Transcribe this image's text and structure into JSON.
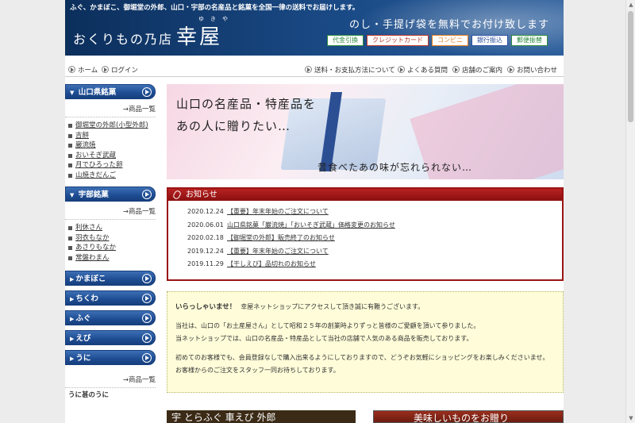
{
  "header": {
    "tagline": "ふぐ、かまぼこ、御堀堂の外郎、山口・宇部の名産品と銘菓を全国一律の送料でお届けします。",
    "logo_small": "おくりもの乃店",
    "logo_big": "幸屋",
    "logo_ruby": "ゆきや",
    "promo": "のし・手提げ袋を無料でお付け致します",
    "payment_badges": [
      {
        "label": "代金引換",
        "color": "#2b8a3e"
      },
      {
        "label": "クレジットカード",
        "color": "#c0392b"
      },
      {
        "label": "コンビニ",
        "color": "#e67e22"
      },
      {
        "label": "銀行振込",
        "color": "#2b4fa0"
      },
      {
        "label": "郵便振替",
        "color": "#2b8a3e"
      }
    ]
  },
  "topnav": {
    "home": "ホーム",
    "login": "ログイン",
    "shipping": "送料・お支払方法について",
    "faq": "よくある質問",
    "stores": "店舗のご案内",
    "contact": "お問い合わせ"
  },
  "sidebar": {
    "more_label": "→商品一覧",
    "yamaguchi": {
      "title": "山口県銘菓",
      "items": [
        "御堀堂の外郎(小型外郎)",
        "吉餅",
        "巌流焼",
        "おいそぎ武蔵",
        "月でひろった卵",
        "山焼きだんご"
      ]
    },
    "ube": {
      "title": "宇部銘菓",
      "items": [
        "利休さん",
        "羽衣もなか",
        "あさりもなか",
        "常盤わまん"
      ]
    },
    "categories": [
      "かまぼこ",
      "ちくわ",
      "ふぐ",
      "えび",
      "うに"
    ],
    "bottom_item": "うに甚のうに"
  },
  "banner": {
    "line1": "山口の名産品・特産品を",
    "line2": "あの人に贈りたい…",
    "line3": "昔食べたあの味が忘れられない…"
  },
  "news": {
    "title": "お知らせ",
    "items": [
      {
        "date": "2020.12.24",
        "title": "【重要】年末年始のご注文について"
      },
      {
        "date": "2020.06.01",
        "title": "山口県銘菓「巌流焼」「おいそぎ武蔵」価格変更のお知らせ"
      },
      {
        "date": "2020.02.18",
        "title": "【御堀堂の外郎】販売終了のお知らせ"
      },
      {
        "date": "2019.12.24",
        "title": "【重要】年末年始のご注文について"
      },
      {
        "date": "2019.11.29",
        "title": "【干しえび】品切れのお知らせ"
      }
    ]
  },
  "welcome": {
    "lead": "いらっしゃいませ！",
    "line1": "幸屋ネットショップにアクセスして頂き誠に有難うございます。",
    "line2": "当社は、山口の「お土産屋さん」として昭和２５年の創業時よりずっと皆様のご愛顧を頂いて参りました。",
    "line3": "当ネットショップでは、山口の名産品・特産品として当社の店舗で人気のある商品を販売しております。",
    "line4": "初めてのお客様でも、会員登録なしで購入出来るようにしておりますので、どうぞお気軽にショッピングをお楽しみくださいませ。",
    "line5": "お客様からのご注文をスタッフ一同お待ちしております。"
  },
  "bottom_banners": {
    "left": "宇 とらふぐ 車えび 外郎",
    "right": "美味しいものをお贈り"
  }
}
